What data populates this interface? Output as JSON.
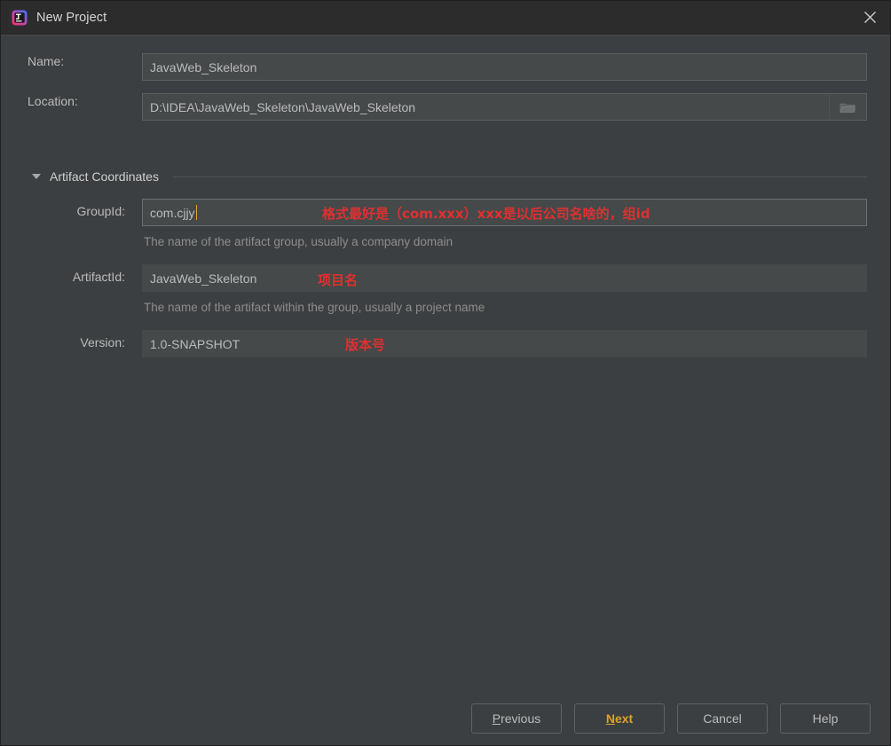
{
  "window": {
    "title": "New Project",
    "app_icon": "intellij-idea-logo",
    "close_icon": "close-icon"
  },
  "form": {
    "name": {
      "label": "Name:",
      "value": "JavaWeb_Skeleton"
    },
    "location": {
      "label": "Location:",
      "value": "D:\\IDEA\\JavaWeb_Skeleton\\JavaWeb_Skeleton",
      "browse_icon": "folder-icon"
    },
    "section": {
      "title": "Artifact Coordinates",
      "expanded": true,
      "collapse_icon": "chevron-down-icon"
    },
    "group_id": {
      "label": "GroupId:",
      "value": "com.cjjy",
      "hint": "The name of the artifact group, usually a company domain",
      "annotation": "格式最好是（com.xxx）xxx是以后公司名啥的，组id",
      "focused": true
    },
    "artifact_id": {
      "label": "ArtifactId:",
      "value": "JavaWeb_Skeleton",
      "hint": "The name of the artifact within the group, usually a project name",
      "annotation": "项目名"
    },
    "version": {
      "label": "Version:",
      "value": "1.0-SNAPSHOT",
      "annotation": "版本号"
    }
  },
  "footer": {
    "previous": {
      "mnemonic": "P",
      "rest": "revious"
    },
    "next": {
      "mnemonic": "N",
      "rest": "ext"
    },
    "cancel": "Cancel",
    "help": "Help"
  },
  "colors": {
    "window_bg": "#3c3f41",
    "titlebar_bg": "#2c2c2c",
    "field_bg": "#45494a",
    "accent_default": "#d8a32b",
    "annotation_red": "#e03030",
    "text": "#bbbbbb",
    "hint_text": "#8c8c8c"
  }
}
